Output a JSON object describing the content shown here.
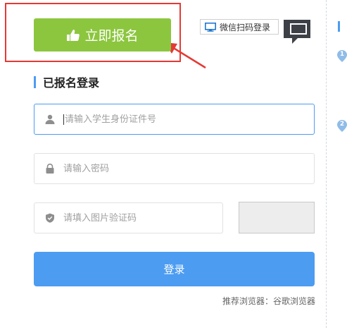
{
  "register": {
    "label": "立即报名",
    "icon": "thumbs-up-icon"
  },
  "wechat": {
    "label": "微信扫码登录",
    "icon": "monitor-icon"
  },
  "qr_toggle": {
    "icon": "qr-corner-icon"
  },
  "login_section": {
    "title": "已报名登录"
  },
  "form": {
    "id_number": {
      "placeholder": "请输入学生身份证件号",
      "value": "",
      "icon": "user-icon"
    },
    "password": {
      "placeholder": "请输入密码",
      "value": "",
      "icon": "lock-icon"
    },
    "captcha": {
      "placeholder": "请填入图片验证码",
      "value": "",
      "icon": "shield-icon"
    },
    "login_label": "登录"
  },
  "browser_tip": "推荐浏览器：谷歌浏览器",
  "side_panel": {
    "steps": [
      "1",
      "2"
    ]
  },
  "colors": {
    "register_green": "#8cc63f",
    "primary_blue": "#4c9cf1",
    "annotation_red": "#e53935"
  }
}
